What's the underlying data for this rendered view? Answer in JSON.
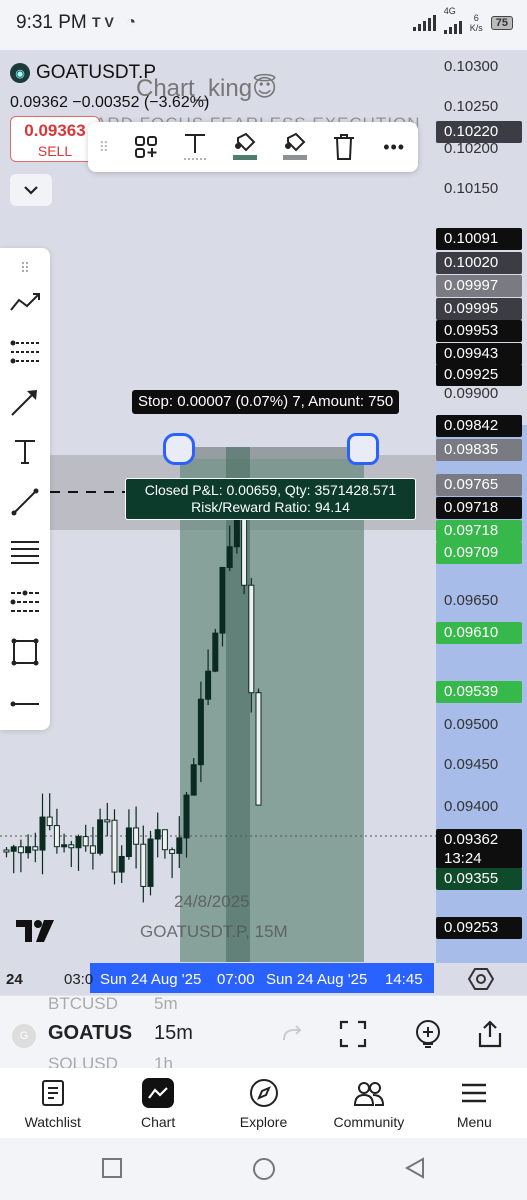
{
  "status_bar": {
    "time": "9:31 PM",
    "left_icons": [
      "tradingview-icon",
      "whatsapp-icon"
    ],
    "network": "4G",
    "speed_value": "6",
    "speed_unit": "K/s",
    "battery": "75"
  },
  "chart": {
    "symbol": "GOATUSDT.P",
    "price_line": "0.09362  −0.00352 (−3.62%)",
    "sell_price": "0.09363",
    "sell_label": "SELL",
    "watermark_title": "Chart_king😇",
    "watermark_sub": "FORWARD FOCUS FEARLESS EXECUTION",
    "stop_tooltip": "Stop: 0.00007 (0.07%) 7, Amount: 750",
    "pnl_line1": "Closed P&L: 0.00659, Qty: 3571428.571",
    "pnl_line2": "Risk/Reward Ratio: 94.14",
    "chart_watermark_date": "24/8/2025",
    "chart_watermark_symbol": "GOATUSDT.P, 15M",
    "axis_labels": [
      "0.10300",
      "0.10250",
      "0.10200",
      "0.10150",
      "0.09900",
      "0.09650",
      "0.09500",
      "0.09450",
      "0.09400"
    ],
    "tags": {
      "t1": "0.10220",
      "t2": "0.10091",
      "t3": "0.10020",
      "t4": "0.09997",
      "t5": "0.09995",
      "t6": "0.09953",
      "t7": "0.09943",
      "t8": "0.09925",
      "t9": "0.09842",
      "t10": "0.09835",
      "t11": "0.09765",
      "t12": "0.09718",
      "t13": "0.09718",
      "t14": "0.09709",
      "t15": "0.09610",
      "t16": "0.09539",
      "t17": "0.09362",
      "t17b": "13:24",
      "t18": "0.09355",
      "t19": "0.09253"
    },
    "time_axis": {
      "left": "24",
      "second": "03:0",
      "range_start": "Sun 24 Aug '25",
      "range_mid": "07:00",
      "range_end": "Sun 24 Aug '25",
      "range_end_time": "14:45"
    }
  },
  "controls": {
    "ghost_top_symbol": "BTCUSD",
    "ghost_top_tf": "5m",
    "symbol": "GOATUS",
    "timeframe": "15m",
    "ghost_bottom_symbol": "SOLUSD",
    "ghost_bottom_tf": "1h"
  },
  "bottom_nav": {
    "watchlist": "Watchlist",
    "chart": "Chart",
    "explore": "Explore",
    "community": "Community",
    "menu": "Menu"
  }
}
